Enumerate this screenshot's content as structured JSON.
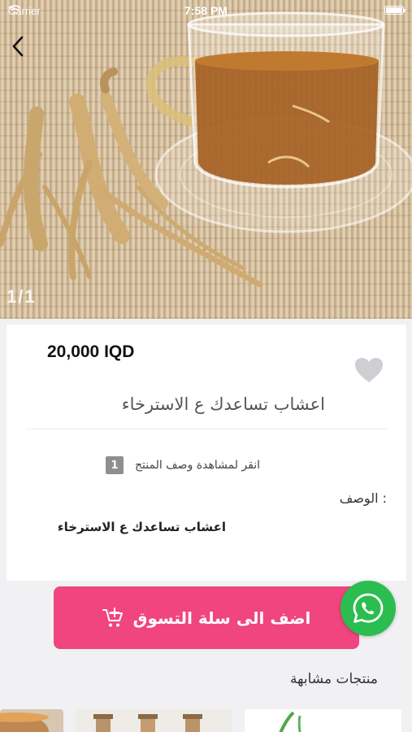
{
  "status_bar": {
    "carrier": "Carrier",
    "time": "7:58 PM"
  },
  "hero": {
    "page_indicator": "1/1"
  },
  "product": {
    "price": "20,000 IQD",
    "name": "اعشاب تساعدك ع الاسترخاء",
    "description_toggle_label": "انقر لمشاهدة وصف المنتج",
    "description_count": "1",
    "description_heading": "الوصف :",
    "description_text": "اعشاب تساعدك ع الاسترخاء"
  },
  "actions": {
    "add_to_cart_label": "اضف الى سلة التسوق",
    "accent_color": "#f0457f",
    "whatsapp_color": "#2bbd4f"
  },
  "similar": {
    "title": "منتجات مشابهة",
    "items": [
      {},
      {},
      {}
    ]
  }
}
